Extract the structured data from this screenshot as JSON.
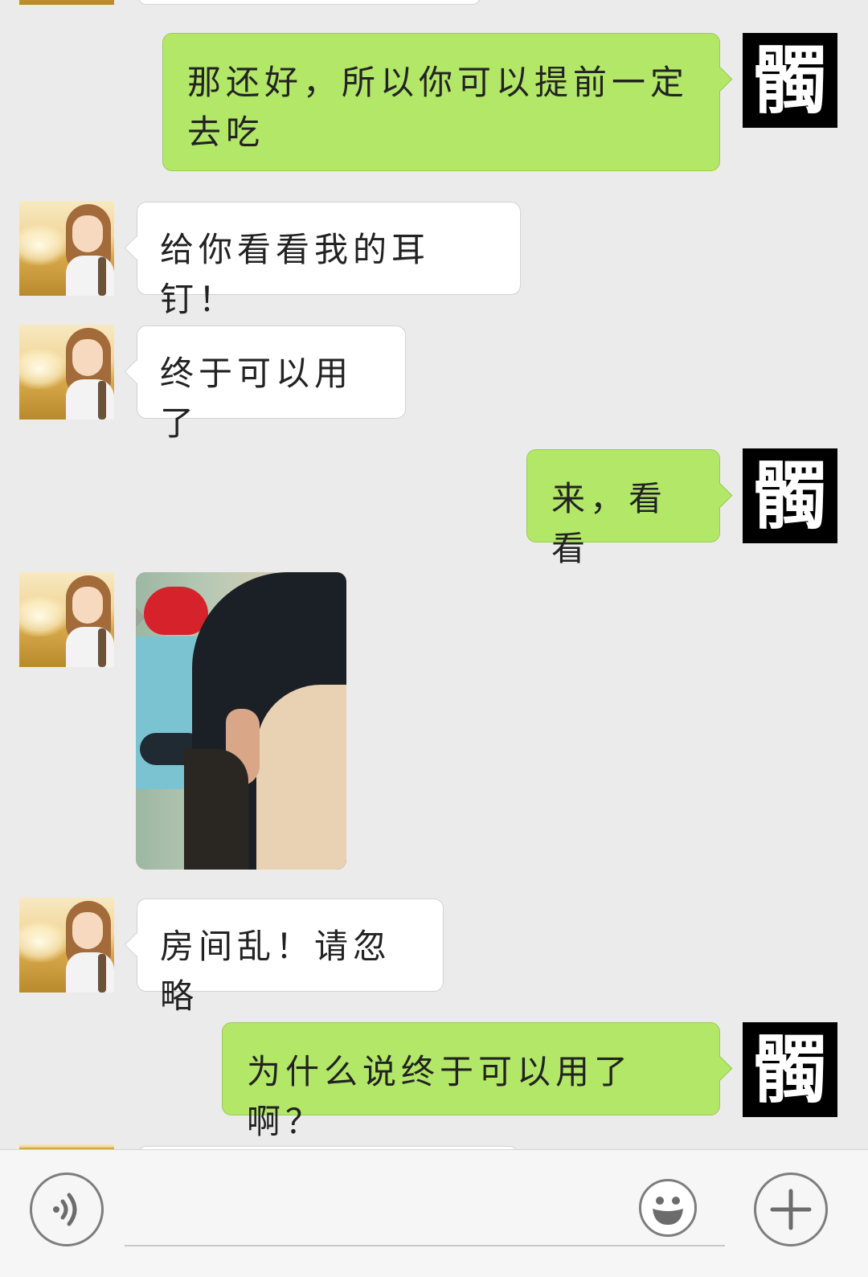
{
  "messages": [
    {
      "side": "out",
      "text": "那还好，所以你可以提前一定去吃"
    },
    {
      "side": "in",
      "text": "给你看看我的耳钉！"
    },
    {
      "side": "in",
      "text": "终于可以用了"
    },
    {
      "side": "out",
      "text": "来，看看"
    },
    {
      "side": "in",
      "type": "image",
      "content": "photo of ear with earring"
    },
    {
      "side": "in",
      "text": "房间乱！请忽略"
    },
    {
      "side": "out",
      "text": "为什么说终于可以用了啊？"
    }
  ],
  "my_avatar_char": "髑",
  "toolbar": {
    "voice_icon": "voice-icon",
    "emoji_icon": "emoji-icon",
    "plus_icon": "plus-icon",
    "input_value": ""
  },
  "colors": {
    "background": "#ebebeb",
    "outgoing_bubble": "#b2e768",
    "incoming_bubble": "#ffffff"
  }
}
